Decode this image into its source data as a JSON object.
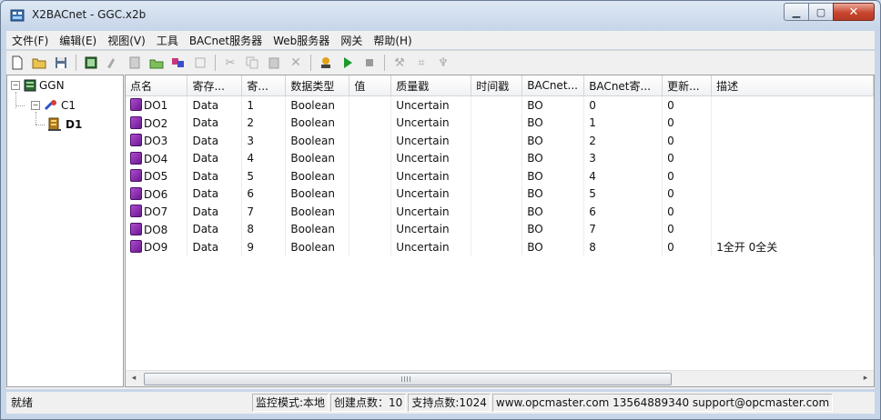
{
  "window": {
    "title": "X2BACnet - GGC.x2b"
  },
  "menu": [
    "文件(F)",
    "编辑(E)",
    "视图(V)",
    "工具",
    "BACnet服务器",
    "Web服务器",
    "网关",
    "帮助(H)"
  ],
  "toolbar": {
    "buttons": [
      "new-icon",
      "open-icon",
      "save-icon",
      "device-icon",
      "tag-icon",
      "table-icon",
      "folder-add-icon",
      "cube-icon",
      "export-icon",
      "cut-icon",
      "copy-icon",
      "paste-icon",
      "delete-icon",
      "monitor-icon",
      "run-icon",
      "stop-icon",
      "tool1-icon",
      "tool2-icon",
      "tool3-icon"
    ]
  },
  "tree": {
    "root": "GGN",
    "channel": "C1",
    "device": "D1"
  },
  "grid": {
    "columns": [
      "点名",
      "寄存...",
      "寄...",
      "数据类型",
      "值",
      "质量戳",
      "时间戳",
      "BACnet...",
      "BACnet寄...",
      "更新...",
      "描述"
    ],
    "rows": [
      [
        "DO1",
        "Data",
        "1",
        "Boolean",
        "",
        "Uncertain",
        "",
        "BO",
        "0",
        "0",
        ""
      ],
      [
        "DO2",
        "Data",
        "2",
        "Boolean",
        "",
        "Uncertain",
        "",
        "BO",
        "1",
        "0",
        ""
      ],
      [
        "DO3",
        "Data",
        "3",
        "Boolean",
        "",
        "Uncertain",
        "",
        "BO",
        "2",
        "0",
        ""
      ],
      [
        "DO4",
        "Data",
        "4",
        "Boolean",
        "",
        "Uncertain",
        "",
        "BO",
        "3",
        "0",
        ""
      ],
      [
        "DO5",
        "Data",
        "5",
        "Boolean",
        "",
        "Uncertain",
        "",
        "BO",
        "4",
        "0",
        ""
      ],
      [
        "DO6",
        "Data",
        "6",
        "Boolean",
        "",
        "Uncertain",
        "",
        "BO",
        "5",
        "0",
        ""
      ],
      [
        "DO7",
        "Data",
        "7",
        "Boolean",
        "",
        "Uncertain",
        "",
        "BO",
        "6",
        "0",
        ""
      ],
      [
        "DO8",
        "Data",
        "8",
        "Boolean",
        "",
        "Uncertain",
        "",
        "BO",
        "7",
        "0",
        ""
      ],
      [
        "DO9",
        "Data",
        "9",
        "Boolean",
        "",
        "Uncertain",
        "",
        "BO",
        "8",
        "0",
        "1全开  0全关"
      ]
    ]
  },
  "status": {
    "ready": "就绪",
    "mode": "监控模式:本地",
    "created": "创建点数：10",
    "supported": "支持点数:1024",
    "contact": "www.opcmaster.com 13564889340 support@opcmaster.com"
  }
}
